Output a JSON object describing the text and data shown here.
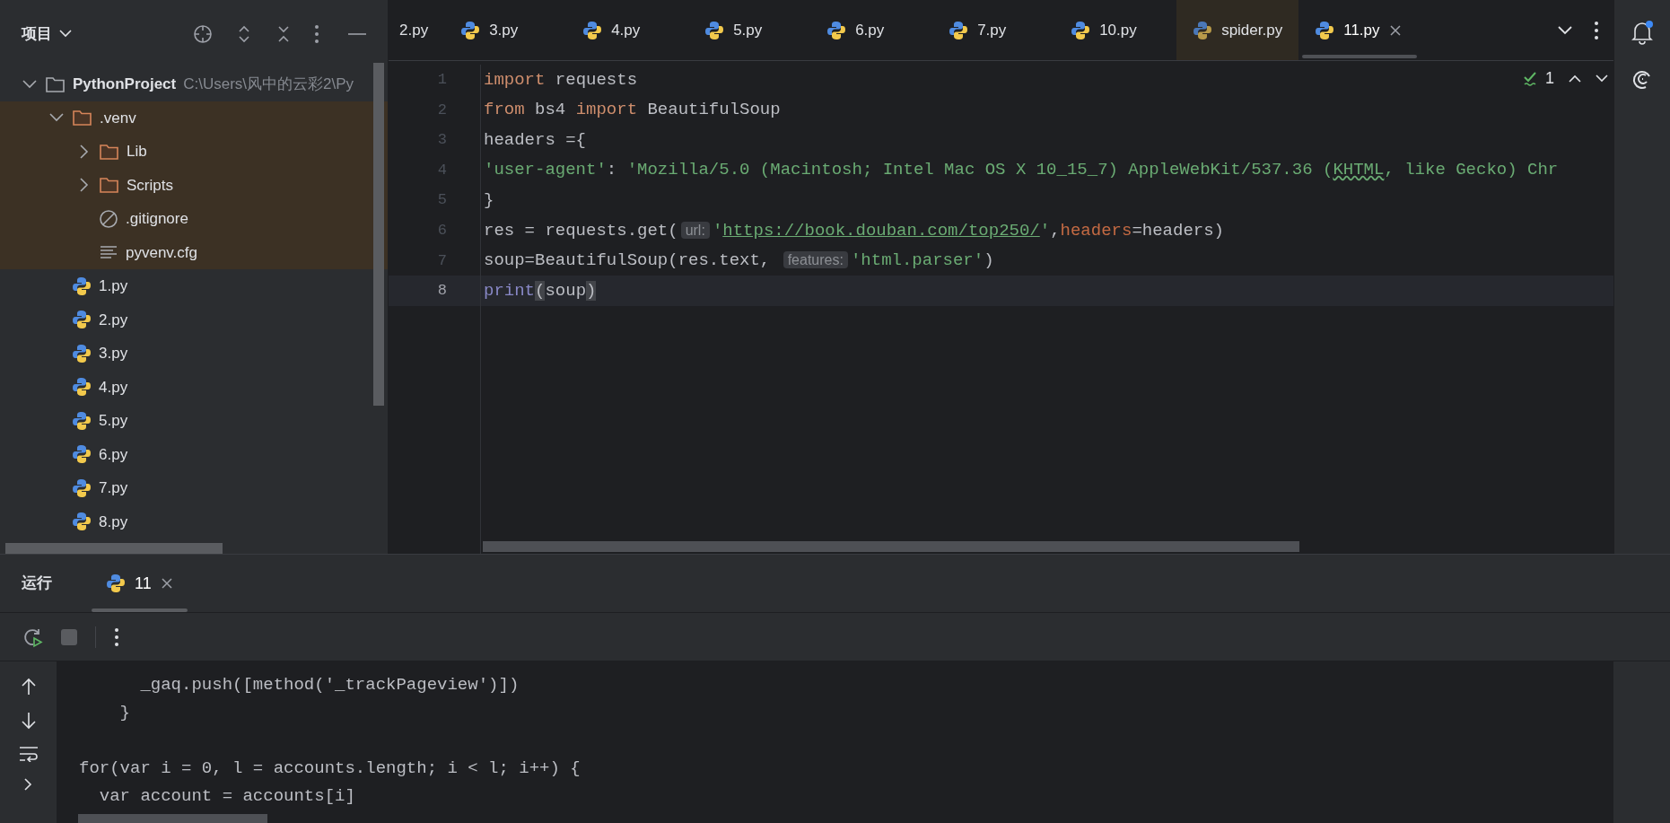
{
  "project_panel": {
    "title": "项目",
    "tree": [
      {
        "name": "PythonProject",
        "path": "C:\\Users\\风中的云彩2\\Py",
        "kind": "folder",
        "expanded": true,
        "excluded": false,
        "children": [
          {
            "name": ".venv",
            "kind": "folder",
            "expanded": true,
            "excluded": true,
            "children": [
              {
                "name": "Lib",
                "kind": "folder",
                "expanded": false,
                "excluded": true
              },
              {
                "name": "Scripts",
                "kind": "folder",
                "expanded": false,
                "excluded": true
              },
              {
                "name": ".gitignore",
                "kind": "ignore",
                "excluded": true
              },
              {
                "name": "pyvenv.cfg",
                "kind": "text",
                "excluded": true
              }
            ]
          },
          {
            "name": "1.py",
            "kind": "python",
            "excluded": false
          },
          {
            "name": "2.py",
            "kind": "python",
            "excluded": false
          },
          {
            "name": "3.py",
            "kind": "python",
            "excluded": false
          },
          {
            "name": "4.py",
            "kind": "python",
            "excluded": false
          },
          {
            "name": "5.py",
            "kind": "python",
            "excluded": false
          },
          {
            "name": "6.py",
            "kind": "python",
            "excluded": false
          },
          {
            "name": "7.py",
            "kind": "python",
            "excluded": false
          },
          {
            "name": "8.py",
            "kind": "python",
            "excluded": false
          }
        ]
      }
    ]
  },
  "tabs": [
    {
      "label": "2.py",
      "selected": false,
      "excluded": false
    },
    {
      "label": "3.py",
      "selected": false,
      "excluded": false
    },
    {
      "label": "4.py",
      "selected": false,
      "excluded": false
    },
    {
      "label": "5.py",
      "selected": false,
      "excluded": false
    },
    {
      "label": "6.py",
      "selected": false,
      "excluded": false
    },
    {
      "label": "7.py",
      "selected": false,
      "excluded": false
    },
    {
      "label": "10.py",
      "selected": false,
      "excluded": false
    },
    {
      "label": "spider.py",
      "selected": false,
      "excluded": true
    },
    {
      "label": "11.py",
      "selected": true,
      "excluded": false
    }
  ],
  "editor": {
    "inspections": "1",
    "lines": [
      {
        "number": "1",
        "selected": false,
        "tokens": [
          {
            "kind": "keyword",
            "text": "import"
          },
          {
            "kind": "plain",
            "text": " requests"
          }
        ]
      },
      {
        "number": "2",
        "selected": false,
        "tokens": [
          {
            "kind": "keyword",
            "text": "from"
          },
          {
            "kind": "plain",
            "text": " bs4 "
          },
          {
            "kind": "keyword",
            "text": "import"
          },
          {
            "kind": "plain",
            "text": " BeautifulSoup"
          }
        ]
      },
      {
        "number": "3",
        "selected": false,
        "tokens": [
          {
            "kind": "plain",
            "text": "headers ={"
          }
        ]
      },
      {
        "number": "4",
        "selected": false,
        "tokens": [
          {
            "kind": "string",
            "text": "'user-agent'"
          },
          {
            "kind": "plain",
            "text": ": "
          },
          {
            "kind": "string",
            "text": "'Mozilla/5.0 (Macintosh; Intel Mac OS X 10_15_7) AppleWebKit/537.36 ("
          },
          {
            "kind": "typo",
            "text": "KHTML"
          },
          {
            "kind": "string",
            "text": ", like Gecko) Chr"
          }
        ]
      },
      {
        "number": "5",
        "selected": false,
        "tokens": [
          {
            "kind": "plain",
            "text": "}"
          }
        ]
      },
      {
        "number": "6",
        "selected": false,
        "tokens": [
          {
            "kind": "plain",
            "text": "res = requests.get("
          },
          {
            "kind": "hint",
            "text": "url:"
          },
          {
            "kind": "string",
            "text": "'"
          },
          {
            "kind": "link",
            "text": "https://book.douban.com/top250/"
          },
          {
            "kind": "string",
            "text": "'"
          },
          {
            "kind": "plain",
            "text": ","
          },
          {
            "kind": "param",
            "text": "headers"
          },
          {
            "kind": "plain",
            "text": "=headers)"
          }
        ]
      },
      {
        "number": "7",
        "selected": false,
        "tokens": [
          {
            "kind": "plain",
            "text": "soup=BeautifulSoup(res.text, "
          },
          {
            "kind": "hint",
            "text": "features:"
          },
          {
            "kind": "string",
            "text": "'html.parser'"
          },
          {
            "kind": "plain",
            "text": ")"
          }
        ]
      },
      {
        "number": "8",
        "selected": true,
        "tokens": [
          {
            "kind": "builtin",
            "text": "print"
          },
          {
            "kind": "brace",
            "text": "("
          },
          {
            "kind": "plain",
            "text": "soup"
          },
          {
            "kind": "brace",
            "text": ")"
          }
        ]
      }
    ]
  },
  "run_panel": {
    "title": "运行",
    "tabs": [
      {
        "label": "11",
        "selected": true
      }
    ],
    "console": [
      {
        "lines": [
          "      _gaq.push([method('_trackPageview')])",
          "    }"
        ]
      },
      {
        "lines": [
          "for(var i = 0, l = accounts.length; i < l; i++) {",
          "  var account = accounts[i]"
        ]
      }
    ]
  }
}
